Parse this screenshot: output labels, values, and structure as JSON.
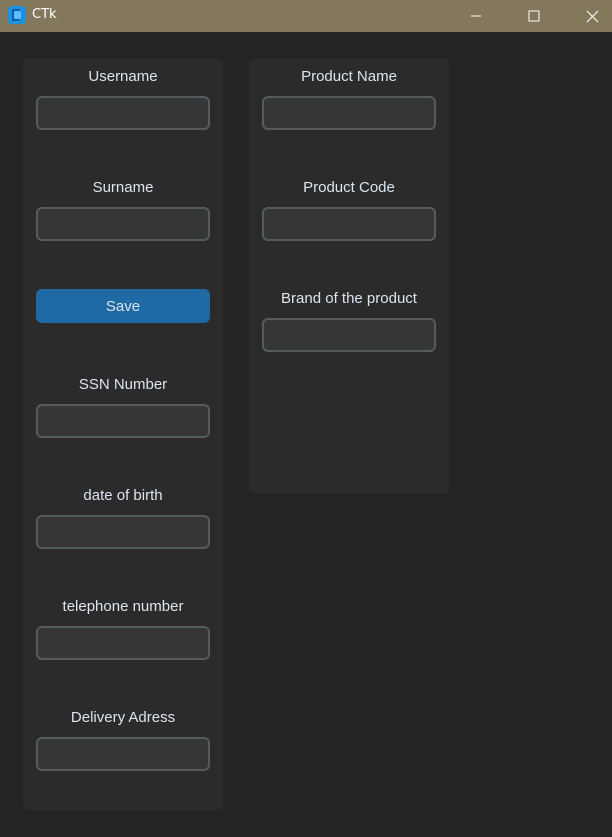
{
  "window": {
    "title": "CTk",
    "app_icon": "ctk-app-icon",
    "controls": {
      "minimize": "minimize-icon",
      "maximize": "maximize-icon",
      "close": "close-icon"
    },
    "colors": {
      "titlebar": "#83785c",
      "background": "#242424",
      "frame": "#2b2b2b",
      "entry": "#343638",
      "entry_border": "#565b5e",
      "button": "#1f6aa5",
      "text": "#dce4ee"
    }
  },
  "left_frame": {
    "username": {
      "label": "Username",
      "value": ""
    },
    "surname": {
      "label": "Surname",
      "value": ""
    },
    "save_button": {
      "label": "Save"
    },
    "ssn": {
      "label": "SSN Number",
      "value": ""
    },
    "dob": {
      "label": "date of birth",
      "value": ""
    },
    "telephone": {
      "label": "telephone number",
      "value": ""
    },
    "delivery": {
      "label": "Delivery Adress",
      "value": ""
    }
  },
  "right_frame": {
    "product_name": {
      "label": "Product Name",
      "value": ""
    },
    "product_code": {
      "label": "Product Code",
      "value": ""
    },
    "brand": {
      "label": "Brand of the product",
      "value": ""
    }
  }
}
